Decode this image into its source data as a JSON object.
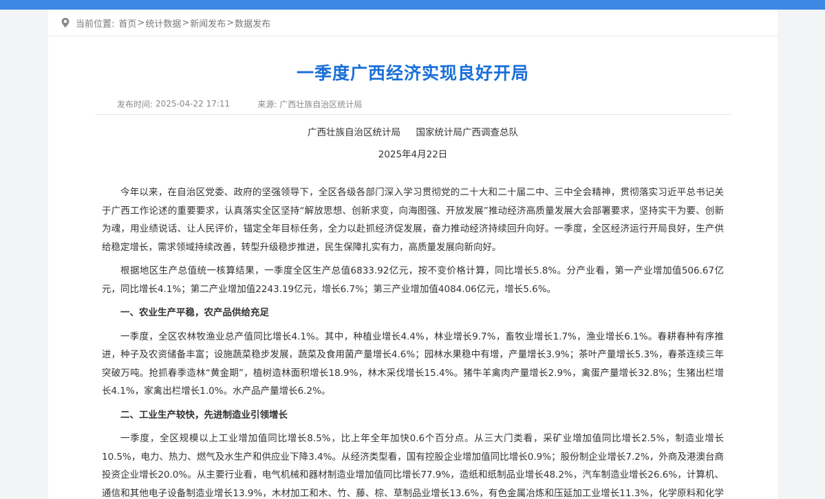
{
  "breadcrumb": {
    "prefix": "当前位置:",
    "items": [
      "首页",
      "统计数据",
      "新闻发布",
      "数据发布"
    ],
    "separator": ">"
  },
  "article": {
    "title": "一季度广西经济实现良好开局",
    "publish_label": "发布时间:",
    "publish_time": "2025-04-22 17:11",
    "source_label": "来源:",
    "source": "广西壮族自治区统计局",
    "issuer_1": "广西壮族自治区统计局",
    "issuer_2": "国家统计局广西调查总队",
    "date": "2025年4月22日",
    "paragraphs": {
      "p1": "今年以来，在自治区党委、政府的坚强领导下，全区各级各部门深入学习贯彻党的二十大和二十届二中、三中全会精神，贯彻落实习近平总书记关于广西工作论述的重要要求，认真落实全区坚持“解放思想、创新求变，向海图强、开放发展”推动经济高质量发展大会部署要求，坚持实干为要、创新为魂，用业绩说话、让人民评价，锚定全年目标任务，全力以赴抓经济促发展，奋力推动经济持续回升向好。一季度，全区经济运行开局良好，生产供给稳定增长，需求领域持续改善，转型升级稳步推进，民生保障扎实有力，高质量发展向新向好。",
      "p2": "根据地区生产总值统一核算结果，一季度全区生产总值6833.92亿元，按不变价格计算，同比增长5.8%。分产业看，第一产业增加值506.67亿元，同比增长4.1%；第二产业增加值2243.19亿元，增长6.7%；第三产业增加值4084.06亿元，增长5.6%。",
      "h1": "一、农业生产平稳，农产品供给充足",
      "p3": "一季度，全区农林牧渔业总产值同比增长4.1%。其中，种植业增长4.4%，林业增长9.7%，畜牧业增长1.7%，渔业增长6.1%。春耕春种有序推进，种子及农资储备丰富；设施蔬菜稳步发展，蔬菜及食用菌产量增长4.6%；园林水果稳中有增，产量增长3.9%；茶叶产量增长5.3%，春茶连续三年突破万吨。抢抓春季造林“黄金期”，植树造林面积增长18.9%，林木采伐增长15.4%。猪牛羊禽肉产量增长2.9%，禽蛋产量增长32.8%；生猪出栏增长4.1%，家禽出栏增长1.0%。水产品产量增长6.2%。",
      "h2": "二、工业生产较快，先进制造业引领增长",
      "p4": "一季度，全区规模以上工业增加值同比增长8.5%，比上年全年加快0.6个百分点。从三大门类看，采矿业增加值同比增长2.5%，制造业增长10.5%，电力、热力、燃气及水生产和供应业下降3.4%。从经济类型看，国有控股企业增加值同比增长0.9%；股份制企业增长7.2%，外商及港澳台商投资企业增长20.0%。从主要行业看，电气机械和器材制造业增加值同比增长77.9%，造纸和纸制品业增长48.2%，汽车制造业增长26.6%，计算机、通信和其他电子设备制造业增长13.9%，木材加工和木、竹、藤、棕、草制品业增长13.6%，有色金属冶炼和压延加工业增长11.3%，化学原料和化学制品制造业增长"
    }
  },
  "colors": {
    "top_bar": "#3d88e3",
    "title": "#1a6fd8",
    "background": "#f3f4f6"
  },
  "icons": {
    "breadcrumb": "location-pin-icon"
  }
}
